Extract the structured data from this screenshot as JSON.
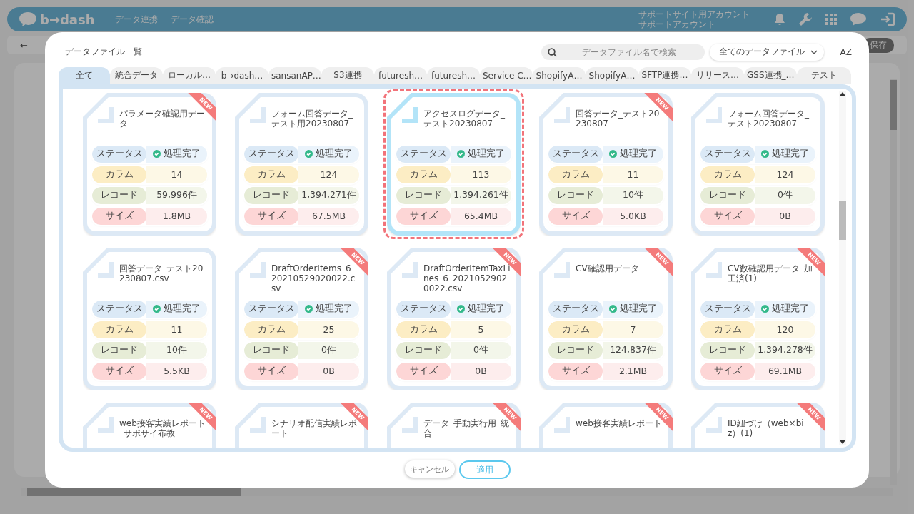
{
  "app_header": {
    "logo": "b→dash",
    "nav": [
      "データ連携",
      "データ確認"
    ],
    "account": [
      "サポートサイト用アカウント",
      "サポートアカウント"
    ]
  },
  "toolbar": {
    "back": "←",
    "save": "保存"
  },
  "dialog": {
    "title": "データファイル一覧",
    "search": {
      "placeholder": "データファイル名で検索"
    },
    "filter": {
      "value": "全てのデータファイル"
    },
    "sort": "AZ",
    "tabs": [
      {
        "label": "全て",
        "selected": true
      },
      {
        "label": "統合データ",
        "selected": false
      },
      {
        "label": "ローカル…",
        "selected": false
      },
      {
        "label": "b→dash…",
        "selected": false
      },
      {
        "label": "sansanAP…",
        "selected": false
      },
      {
        "label": "S3連携",
        "selected": false
      },
      {
        "label": "futuresh…",
        "selected": false
      },
      {
        "label": "futuresh…",
        "selected": false
      },
      {
        "label": "Service C…",
        "selected": false
      },
      {
        "label": "ShopifyA…",
        "selected": false
      },
      {
        "label": "ShopifyA…",
        "selected": false
      },
      {
        "label": "SFTP連携…",
        "selected": false
      },
      {
        "label": "リリース…",
        "selected": false
      },
      {
        "label": "GSS連携_…",
        "selected": false
      },
      {
        "label": "テスト",
        "selected": false
      }
    ],
    "files": [
      {
        "title": "パラメータ確認用データ",
        "badge": "NEW",
        "selected": false,
        "rows": [
          {
            "kind": "status",
            "label": "ステータス",
            "value": "処理完了"
          },
          {
            "kind": "column",
            "label": "カラム",
            "value": "14"
          },
          {
            "kind": "record",
            "label": "レコード",
            "value": "59,996件"
          },
          {
            "kind": "size",
            "label": "サイズ",
            "value": "1.8MB"
          }
        ]
      },
      {
        "title": "フォーム回答データ_テスト用20230807",
        "selected": false,
        "rows": [
          {
            "kind": "status",
            "label": "ステータス",
            "value": "処理完了"
          },
          {
            "kind": "column",
            "label": "カラム",
            "value": "124"
          },
          {
            "kind": "record",
            "label": "レコード",
            "value": "1,394,271件"
          },
          {
            "kind": "size",
            "label": "サイズ",
            "value": "67.5MB"
          }
        ]
      },
      {
        "title": "アクセスログデータ_テスト20230807",
        "selected": true,
        "rows": [
          {
            "kind": "status",
            "label": "ステータス",
            "value": "処理完了"
          },
          {
            "kind": "column",
            "label": "カラム",
            "value": "113"
          },
          {
            "kind": "record",
            "label": "レコード",
            "value": "1,394,261件"
          },
          {
            "kind": "size",
            "label": "サイズ",
            "value": "65.4MB"
          }
        ]
      },
      {
        "title": "回答データ_テスト20230807",
        "badge": "NEW",
        "selected": false,
        "rows": [
          {
            "kind": "status",
            "label": "ステータス",
            "value": "処理完了"
          },
          {
            "kind": "column",
            "label": "カラム",
            "value": "11"
          },
          {
            "kind": "record",
            "label": "レコード",
            "value": "10件"
          },
          {
            "kind": "size",
            "label": "サイズ",
            "value": "5.0KB"
          }
        ]
      },
      {
        "title": "フォーム回答データ_テスト20230807",
        "selected": false,
        "rows": [
          {
            "kind": "status",
            "label": "ステータス",
            "value": "処理完了"
          },
          {
            "kind": "column",
            "label": "カラム",
            "value": "124"
          },
          {
            "kind": "record",
            "label": "レコード",
            "value": "0件"
          },
          {
            "kind": "size",
            "label": "サイズ",
            "value": "0B"
          }
        ]
      },
      {
        "title": "回答データ_テスト20230807.csv",
        "selected": false,
        "rows": [
          {
            "kind": "status",
            "label": "ステータス",
            "value": "処理完了"
          },
          {
            "kind": "column",
            "label": "カラム",
            "value": "11"
          },
          {
            "kind": "record",
            "label": "レコード",
            "value": "10件"
          },
          {
            "kind": "size",
            "label": "サイズ",
            "value": "5.5KB"
          }
        ]
      },
      {
        "title": "DraftOrderItems_6_20210529020022.csv",
        "badge": "NEW",
        "selected": false,
        "rows": [
          {
            "kind": "status",
            "label": "ステータス",
            "value": "処理完了"
          },
          {
            "kind": "column",
            "label": "カラム",
            "value": "25"
          },
          {
            "kind": "record",
            "label": "レコード",
            "value": "0件"
          },
          {
            "kind": "size",
            "label": "サイズ",
            "value": "0B"
          }
        ]
      },
      {
        "title": "DraftOrderItemTaxLines_6_20210529020022.csv",
        "badge": "NEW",
        "selected": false,
        "rows": [
          {
            "kind": "status",
            "label": "ステータス",
            "value": "処理完了"
          },
          {
            "kind": "column",
            "label": "カラム",
            "value": "5"
          },
          {
            "kind": "record",
            "label": "レコード",
            "value": "0件"
          },
          {
            "kind": "size",
            "label": "サイズ",
            "value": "0B"
          }
        ]
      },
      {
        "title": "CV確認用データ",
        "badge": "NEW",
        "selected": false,
        "rows": [
          {
            "kind": "status",
            "label": "ステータス",
            "value": "処理完了"
          },
          {
            "kind": "column",
            "label": "カラム",
            "value": "7"
          },
          {
            "kind": "record",
            "label": "レコード",
            "value": "124,837件"
          },
          {
            "kind": "size",
            "label": "サイズ",
            "value": "2.1MB"
          }
        ]
      },
      {
        "title": "CV数確認用データ_加工済(1)",
        "badge": "NEW",
        "selected": false,
        "rows": [
          {
            "kind": "status",
            "label": "ステータス",
            "value": "処理完了"
          },
          {
            "kind": "column",
            "label": "カラム",
            "value": "120"
          },
          {
            "kind": "record",
            "label": "レコード",
            "value": "1,394,278件"
          },
          {
            "kind": "size",
            "label": "サイズ",
            "value": "69.1MB"
          }
        ]
      },
      {
        "title": "web接客実績レポート_サポサイ布教",
        "badge": "NEW",
        "selected": false
      },
      {
        "title": "シナリオ配信実績レポート",
        "badge": "NEW",
        "selected": false
      },
      {
        "title": "データ_手動実行用_統合",
        "badge": "NEW",
        "selected": false
      },
      {
        "title": "web接客実績レポート",
        "badge": "NEW",
        "selected": false
      },
      {
        "title": "ID紐づけ（web×biz）(1)",
        "badge": "NEW",
        "selected": false
      }
    ],
    "buttons": {
      "cancel": "キャンセル",
      "apply": "適用"
    }
  }
}
